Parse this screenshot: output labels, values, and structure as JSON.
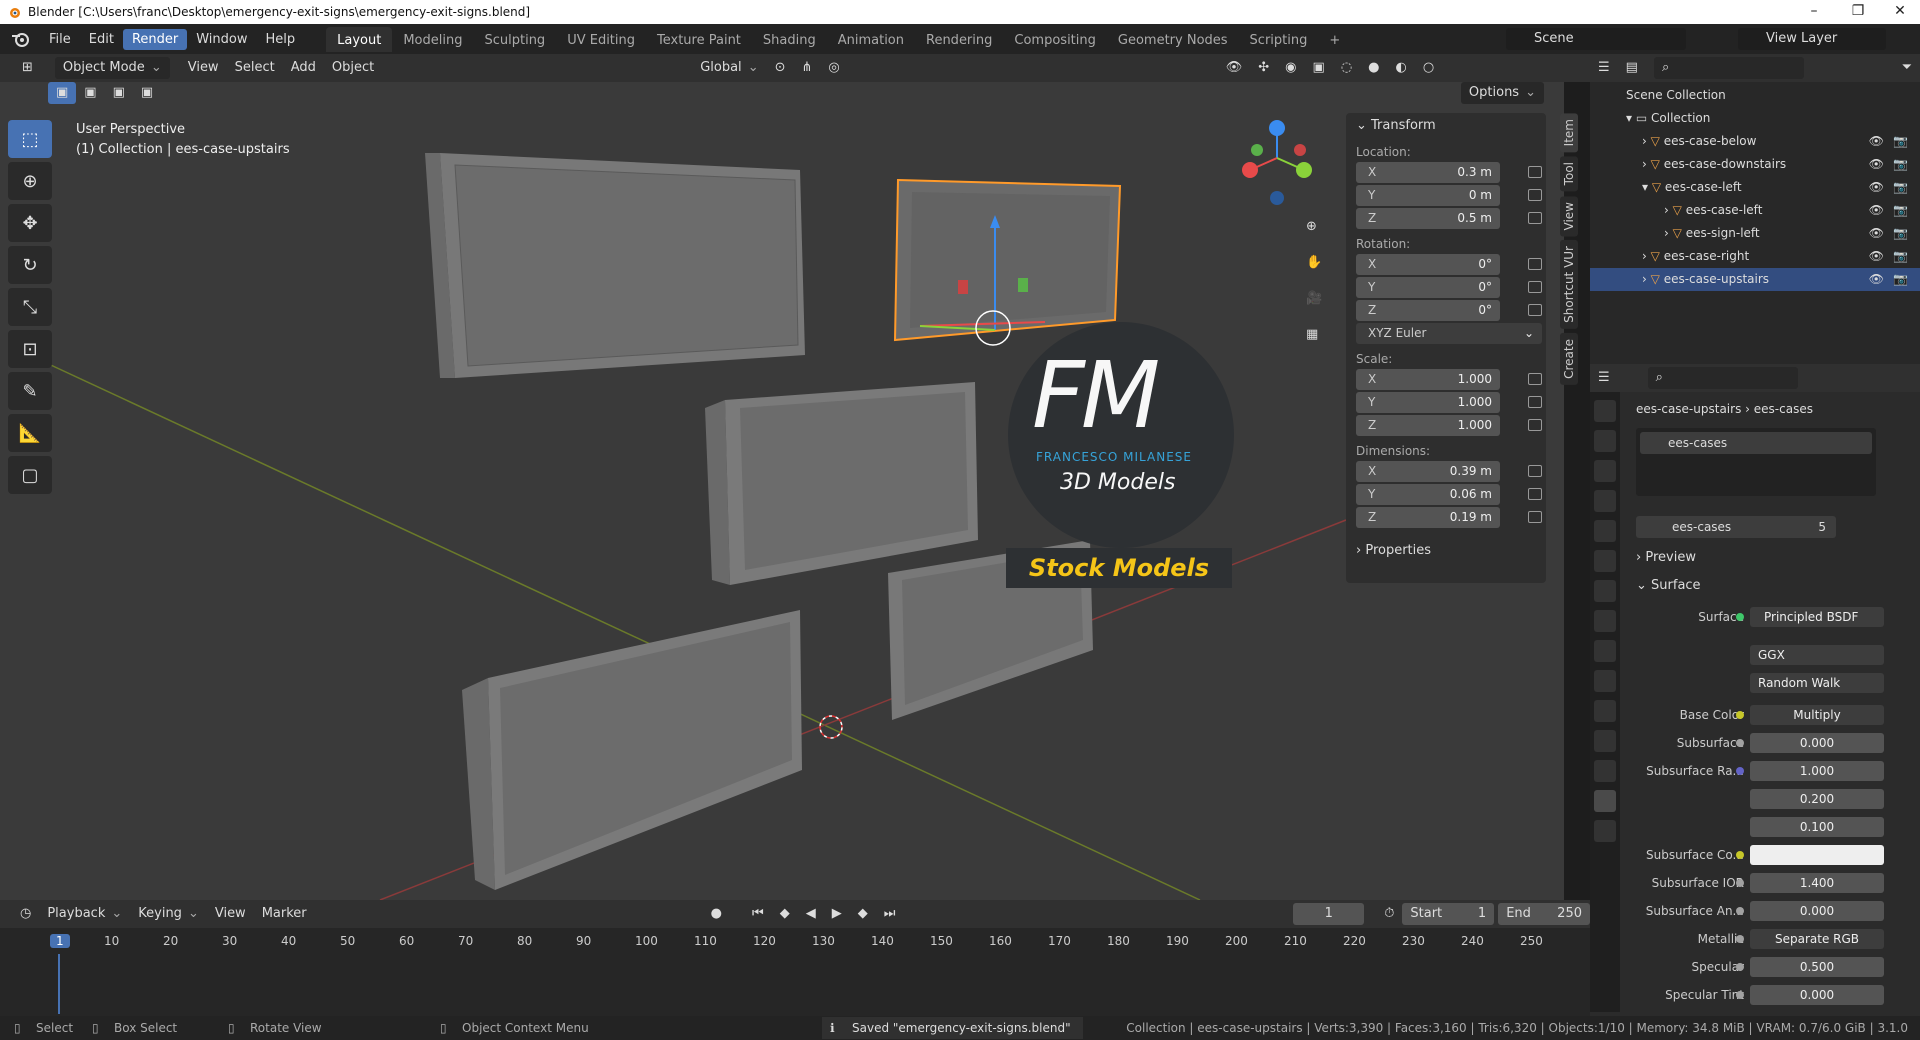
{
  "title": "Blender [C:\\Users\\franc\\Desktop\\emergency-exit-signs\\emergency-exit-signs.blend]",
  "menus": [
    "File",
    "Edit",
    "Render",
    "Window",
    "Help"
  ],
  "workspaces": [
    "Layout",
    "Modeling",
    "Sculpting",
    "UV Editing",
    "Texture Paint",
    "Shading",
    "Animation",
    "Rendering",
    "Compositing",
    "Geometry Nodes",
    "Scripting"
  ],
  "scene": "Scene",
  "view_layer": "View Layer",
  "viewport_header": {
    "mode": "Object Mode",
    "menus": [
      "View",
      "Select",
      "Add",
      "Object"
    ],
    "orientation": "Global",
    "options": "Options"
  },
  "overlay": {
    "perspective": "User Perspective",
    "collection": "(1) Collection | ees-case-upstairs"
  },
  "watermark": {
    "logo": "FM",
    "name": "FRANCESCO MILANESE",
    "sub": "3D Models",
    "tag": "Stock Models"
  },
  "npanel": {
    "transform": "Transform",
    "location_label": "Location:",
    "location": [
      {
        "k": "X",
        "v": "0.3 m"
      },
      {
        "k": "Y",
        "v": "0 m"
      },
      {
        "k": "Z",
        "v": "0.5 m"
      }
    ],
    "rotation_label": "Rotation:",
    "rotation": [
      {
        "k": "X",
        "v": "0°"
      },
      {
        "k": "Y",
        "v": "0°"
      },
      {
        "k": "Z",
        "v": "0°"
      }
    ],
    "rotation_mode": "XYZ Euler",
    "scale_label": "Scale:",
    "scale": [
      {
        "k": "X",
        "v": "1.000"
      },
      {
        "k": "Y",
        "v": "1.000"
      },
      {
        "k": "Z",
        "v": "1.000"
      }
    ],
    "dimensions_label": "Dimensions:",
    "dimensions": [
      {
        "k": "X",
        "v": "0.39 m"
      },
      {
        "k": "Y",
        "v": "0.06 m"
      },
      {
        "k": "Z",
        "v": "0.19 m"
      }
    ],
    "properties": "Properties",
    "tabs": [
      "Item",
      "Tool",
      "View",
      "Shortcut VUr",
      "Create"
    ]
  },
  "outliner": {
    "root": "Scene Collection",
    "collection": "Collection",
    "items": [
      "ees-case-below",
      "ees-case-downstairs",
      "ees-case-left",
      "ees-case-left",
      "ees-sign-left",
      "ees-case-right",
      "ees-case-upstairs"
    ]
  },
  "properties": {
    "breadcrumb_object": "ees-case-upstairs",
    "breadcrumb_material": "ees-cases",
    "slot": "ees-cases",
    "material": "ees-cases",
    "users": "5",
    "preview": "Preview",
    "surface_header": "Surface",
    "surface_label": "Surface",
    "surface_value": "Principled BSDF",
    "distribution": "GGX",
    "subsurface_method": "Random Walk",
    "rows": [
      {
        "l": "Base Color",
        "v": "Multiply",
        "c": "#c7c729"
      },
      {
        "l": "Subsurface",
        "v": "0.000",
        "c": "#a1a1a1"
      },
      {
        "l": "Subsurface Ra...",
        "v": "1.000",
        "c": "#6363c7"
      },
      {
        "l": "",
        "v": "0.200",
        "c": ""
      },
      {
        "l": "",
        "v": "0.100",
        "c": ""
      },
      {
        "l": "Subsurface Co...",
        "v": "",
        "c": "#c7c729"
      },
      {
        "l": "Subsurface IOR",
        "v": "1.400",
        "c": "#a1a1a1"
      },
      {
        "l": "Subsurface An...",
        "v": "0.000",
        "c": "#a1a1a1"
      },
      {
        "l": "Metallic",
        "v": "Separate RGB",
        "c": "#a1a1a1"
      },
      {
        "l": "Specular",
        "v": "0.500",
        "c": "#a1a1a1"
      },
      {
        "l": "Specular Tint",
        "v": "0.000",
        "c": "#a1a1a1"
      }
    ]
  },
  "timeline": {
    "menus": [
      "Playback",
      "Keying",
      "View",
      "Marker"
    ],
    "current": "1",
    "start_label": "Start",
    "start": "1",
    "end_label": "End",
    "end": "250",
    "ticks": [
      "1",
      "10",
      "20",
      "30",
      "40",
      "50",
      "60",
      "70",
      "80",
      "90",
      "100",
      "110",
      "120",
      "130",
      "140",
      "150",
      "160",
      "170",
      "180",
      "190",
      "200",
      "210",
      "220",
      "230",
      "240",
      "250"
    ]
  },
  "status": {
    "select": "Select",
    "box": "Box Select",
    "rotate": "Rotate View",
    "context": "Object Context Menu",
    "saved": "Saved \"emergency-exit-signs.blend\"",
    "info": "Collection | ees-case-upstairs | Verts:3,390 | Faces:3,160 | Tris:6,320 | Objects:1/10 | Memory: 34.8 MiB | VRAM: 0.7/6.0 GiB | 3.1.0"
  }
}
